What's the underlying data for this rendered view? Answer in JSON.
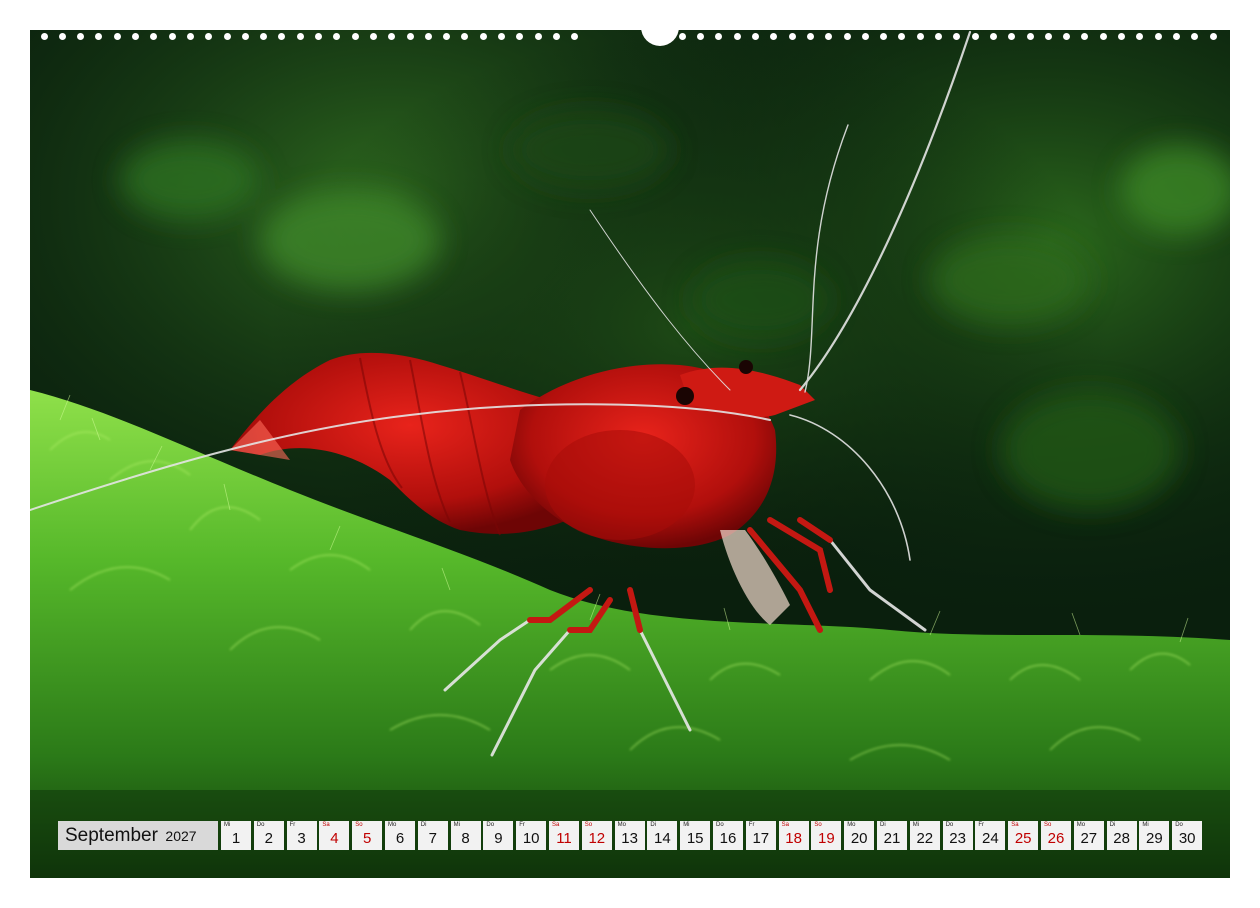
{
  "photo": {
    "subject_icon": "red-shrimp-on-moss-photo"
  },
  "calendar": {
    "month": "September",
    "year": "2027",
    "weekend_color": "#c00000",
    "days": [
      {
        "weekday": "Mi",
        "day": "1",
        "weekend": false
      },
      {
        "weekday": "Do",
        "day": "2",
        "weekend": false
      },
      {
        "weekday": "Fr",
        "day": "3",
        "weekend": false
      },
      {
        "weekday": "Sa",
        "day": "4",
        "weekend": true
      },
      {
        "weekday": "So",
        "day": "5",
        "weekend": true
      },
      {
        "weekday": "Mo",
        "day": "6",
        "weekend": false
      },
      {
        "weekday": "Di",
        "day": "7",
        "weekend": false
      },
      {
        "weekday": "Mi",
        "day": "8",
        "weekend": false
      },
      {
        "weekday": "Do",
        "day": "9",
        "weekend": false
      },
      {
        "weekday": "Fr",
        "day": "10",
        "weekend": false
      },
      {
        "weekday": "Sa",
        "day": "11",
        "weekend": true
      },
      {
        "weekday": "So",
        "day": "12",
        "weekend": true
      },
      {
        "weekday": "Mo",
        "day": "13",
        "weekend": false
      },
      {
        "weekday": "Di",
        "day": "14",
        "weekend": false
      },
      {
        "weekday": "Mi",
        "day": "15",
        "weekend": false
      },
      {
        "weekday": "Do",
        "day": "16",
        "weekend": false
      },
      {
        "weekday": "Fr",
        "day": "17",
        "weekend": false
      },
      {
        "weekday": "Sa",
        "day": "18",
        "weekend": true
      },
      {
        "weekday": "So",
        "day": "19",
        "weekend": true
      },
      {
        "weekday": "Mo",
        "day": "20",
        "weekend": false
      },
      {
        "weekday": "Di",
        "day": "21",
        "weekend": false
      },
      {
        "weekday": "Mi",
        "day": "22",
        "weekend": false
      },
      {
        "weekday": "Do",
        "day": "23",
        "weekend": false
      },
      {
        "weekday": "Fr",
        "day": "24",
        "weekend": false
      },
      {
        "weekday": "Sa",
        "day": "25",
        "weekend": true
      },
      {
        "weekday": "So",
        "day": "26",
        "weekend": true
      },
      {
        "weekday": "Mo",
        "day": "27",
        "weekend": false
      },
      {
        "weekday": "Di",
        "day": "28",
        "weekend": false
      },
      {
        "weekday": "Mi",
        "day": "29",
        "weekend": false
      },
      {
        "weekday": "Do",
        "day": "30",
        "weekend": false
      }
    ]
  }
}
